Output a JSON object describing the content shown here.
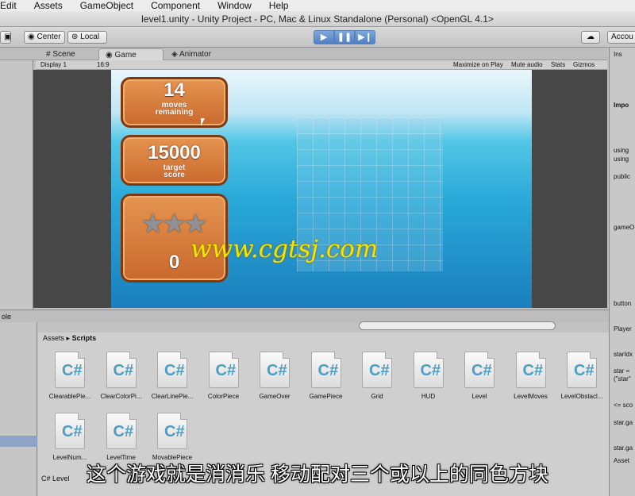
{
  "menubar": {
    "items": [
      "Edit",
      "Assets",
      "GameObject",
      "Component",
      "Window",
      "Help"
    ]
  },
  "window": {
    "title": "level1.unity - Unity Project - PC, Mac & Linux Standalone (Personal) <OpenGL 4.1>"
  },
  "toolbar": {
    "pivot": "Center",
    "space": "Local",
    "account": "Accou"
  },
  "tabs": {
    "scene": "Scene",
    "game": "Game",
    "animator": "Animator"
  },
  "gamebar": {
    "display": "Display 1",
    "aspect": "16:9",
    "maximize": "Maximize on Play",
    "mute": "Mute audio",
    "stats": "Stats",
    "gizmos": "Gizmos"
  },
  "hud": {
    "moves_value": "14",
    "moves_label": "moves\nremaining",
    "target_value": "15000",
    "target_label": "target\nscore",
    "score_value": "0"
  },
  "watermark": "www.cgtsj.com",
  "project": {
    "breadcrumb_root": "Assets",
    "breadcrumb_folder": "Scripts",
    "bottom_left": "ole",
    "files": [
      "ClearablePie...",
      "ClearColorPi...",
      "ClearLinePie...",
      "ColorPiece",
      "GameOver",
      "GamePiece",
      "Grid",
      "HUD",
      "Level",
      "LevelMoves",
      "LevelObstacl...",
      "LevelNum...",
      "LevelTime",
      "MovablePiece"
    ],
    "footer": "Level"
  },
  "inspector": {
    "lines": [
      "Ins",
      "Impo",
      "using",
      "using",
      "public",
      "gameO",
      "button",
      "Player",
      "starIdx",
      "star =",
      "(\"star\"",
      "<= sco",
      "star.ga",
      "star.ga",
      "Asset"
    ]
  },
  "subtitle": "这个游戏就是消消乐 移动配对三个或以上的同色方块",
  "colors": {
    "accent_play": "#4f7fc4",
    "wood": "#d87a3a",
    "sea": "#29a8d8",
    "watermark": "#f6e400"
  }
}
